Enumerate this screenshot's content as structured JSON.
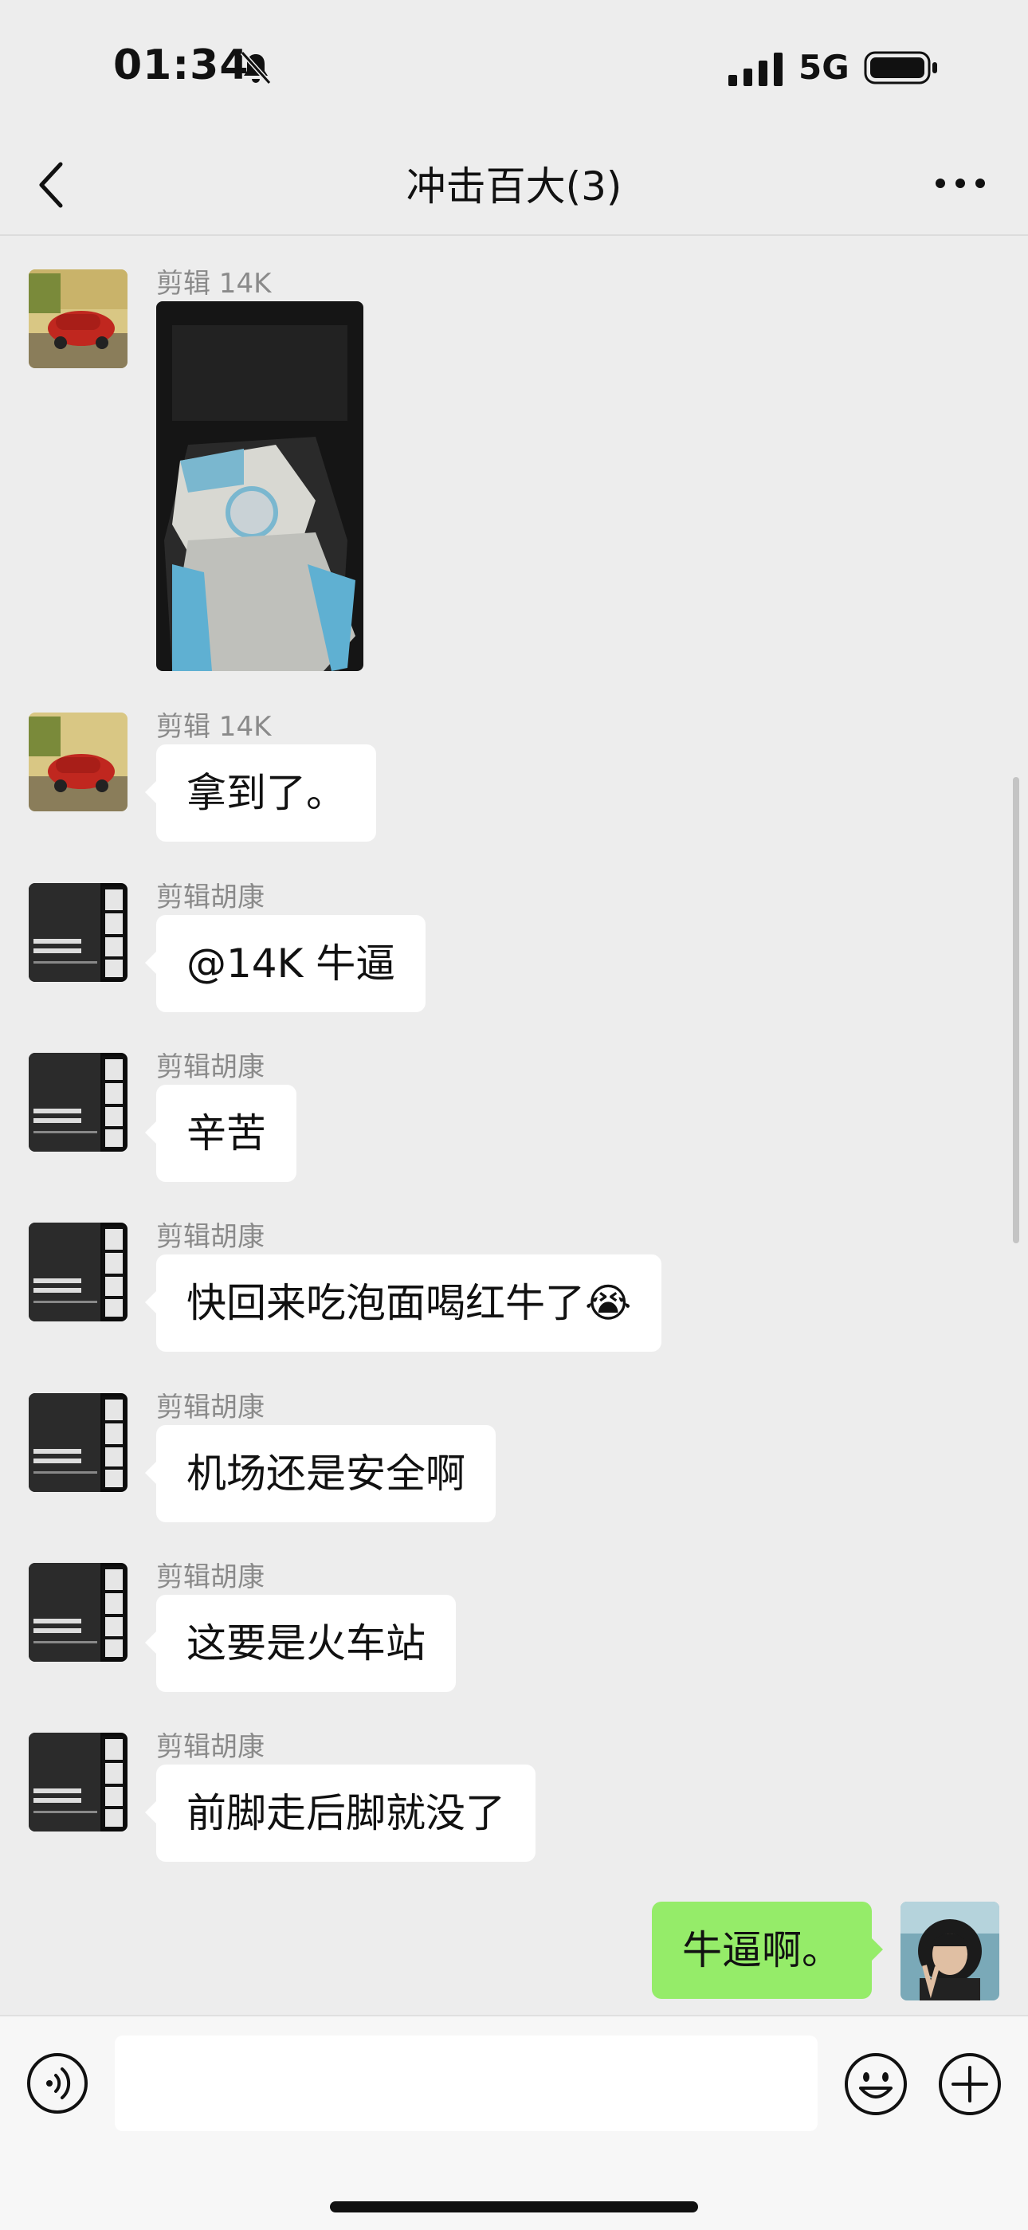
{
  "status_bar": {
    "time": "01:34",
    "network": "5G",
    "icons": [
      "bell-muted-icon",
      "signal-icon",
      "battery-icon"
    ]
  },
  "nav": {
    "title": "冲击百大(3)",
    "icons": [
      "chevron-left-icon",
      "more-icon"
    ]
  },
  "messages": [
    {
      "sender": "剪辑 14K",
      "type": "image",
      "avatar": "red-car-avatar"
    },
    {
      "sender": "剪辑 14K",
      "type": "text",
      "text": "拿到了。",
      "avatar": "red-car-avatar"
    },
    {
      "sender": "剪辑胡康",
      "type": "text",
      "text": "@14K 牛逼",
      "avatar": "poster-avatar"
    },
    {
      "sender": "剪辑胡康",
      "type": "text",
      "text": "辛苦",
      "avatar": "poster-avatar"
    },
    {
      "sender": "剪辑胡康",
      "type": "text",
      "text": "快回来吃泡面喝红牛了",
      "emoji": "😭",
      "avatar": "poster-avatar"
    },
    {
      "sender": "剪辑胡康",
      "type": "text",
      "text": "机场还是安全啊",
      "avatar": "poster-avatar"
    },
    {
      "sender": "剪辑胡康",
      "type": "text",
      "text": "这要是火车站",
      "avatar": "poster-avatar"
    },
    {
      "sender": "剪辑胡康",
      "type": "text",
      "text": "前脚走后脚就没了",
      "avatar": "poster-avatar"
    },
    {
      "sender": "",
      "type": "text",
      "text": "牛逼啊。",
      "from_me": true,
      "avatar": "self-avatar"
    }
  ],
  "input_bar": {
    "placeholder": "",
    "icons": [
      "voice-icon",
      "emoji-icon",
      "plus-icon"
    ]
  },
  "colors": {
    "background": "#ededed",
    "bubble_incoming": "#ffffff",
    "bubble_outgoing": "#95ec69",
    "sender_name": "#8a8a8a"
  }
}
